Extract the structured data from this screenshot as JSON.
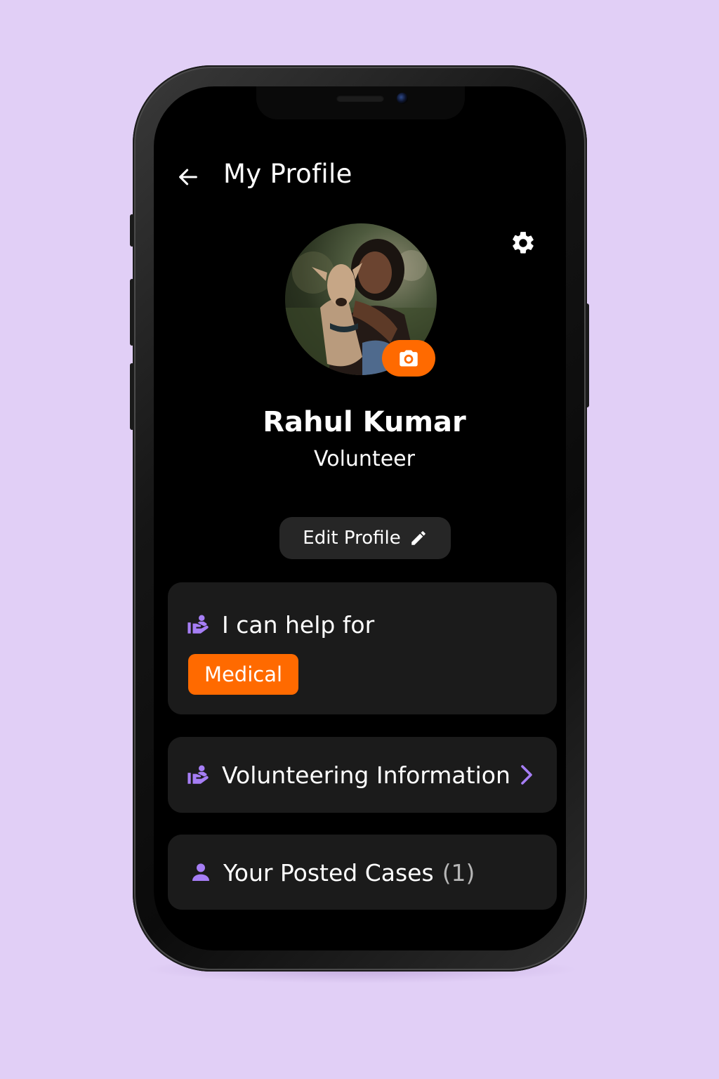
{
  "header": {
    "title": "My Profile",
    "back_icon": "arrow-left-icon",
    "settings_icon": "gear-icon"
  },
  "profile": {
    "name": "Rahul Kumar",
    "role": "Volunteer",
    "avatar_icon": "camera-icon",
    "edit_label": "Edit Profile",
    "edit_icon": "pencil-icon"
  },
  "help_card": {
    "heading": "I can help for",
    "icon": "helping-hand-icon",
    "tags": [
      "Medical"
    ]
  },
  "volunteering_card": {
    "label": "Volunteering Information",
    "icon": "helping-hand-icon",
    "chevron_icon": "chevron-right-icon"
  },
  "cases_card": {
    "label": "Your Posted Cases",
    "count": "(1)",
    "icon": "person-icon"
  },
  "colors": {
    "background": "#e1cff6",
    "screen": "#000000",
    "card": "#1b1b1b",
    "accent_orange": "#ff6a00",
    "accent_purple": "#a67ef5"
  }
}
